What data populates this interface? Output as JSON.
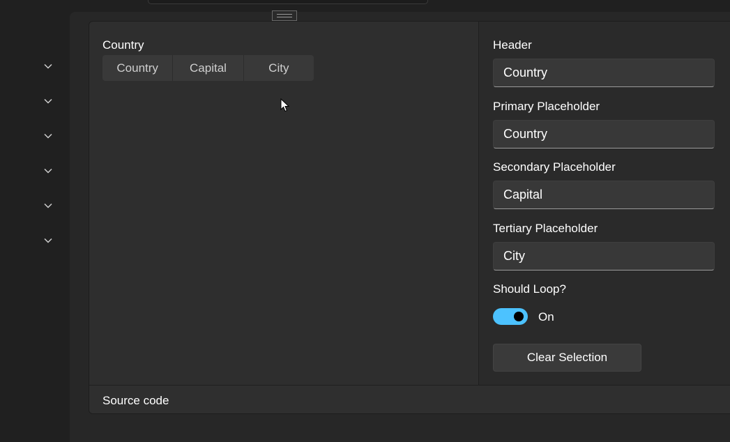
{
  "nav": {
    "items": [
      {
        "icon": "chevron-down-icon"
      },
      {
        "icon": "chevron-down-icon"
      },
      {
        "icon": "chevron-down-icon"
      },
      {
        "icon": "chevron-down-icon"
      },
      {
        "icon": "chevron-down-icon"
      },
      {
        "icon": "chevron-down-icon"
      }
    ]
  },
  "example": {
    "header": "Country",
    "picker": {
      "segments": [
        "Country",
        "Capital",
        "City"
      ]
    }
  },
  "options": {
    "header_label": "Header",
    "header_value": "Country",
    "primary_label": "Primary Placeholder",
    "primary_value": "Country",
    "secondary_label": "Secondary Placeholder",
    "secondary_value": "Capital",
    "tertiary_label": "Tertiary Placeholder",
    "tertiary_value": "City",
    "loop_label": "Should Loop?",
    "loop_state": "On",
    "loop_on": true,
    "clear_button": "Clear Selection"
  },
  "source": {
    "label": "Source code"
  },
  "colors": {
    "accent": "#4cc2ff",
    "background": "#202020",
    "card": "#2c2c2c"
  }
}
